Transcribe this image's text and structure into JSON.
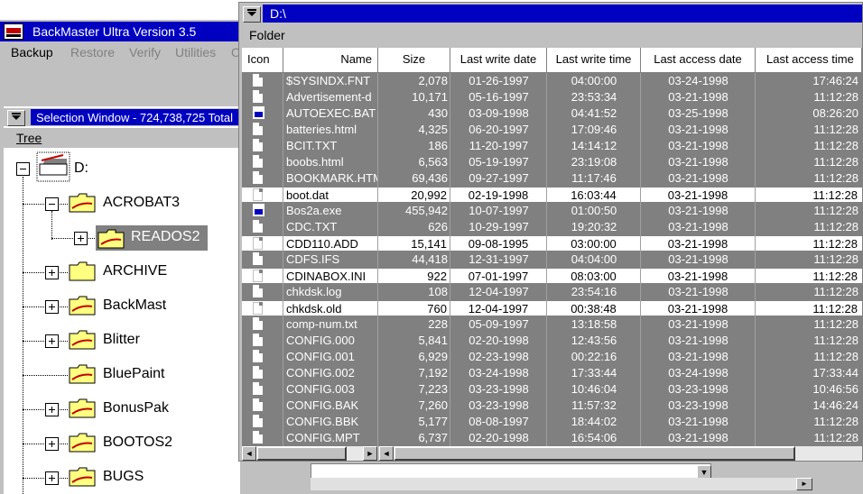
{
  "main_window": {
    "title": "BackMaster Ultra Version 3.5",
    "menu": [
      "Backup",
      "Restore",
      "Verify",
      "Utilities",
      "O"
    ]
  },
  "selection_window": {
    "title": "Selection Window - 724,738,725 Total",
    "menu_tree": "Tree",
    "drive_label": "D:",
    "tree": [
      {
        "label": "ACROBAT3",
        "expander": "minus"
      },
      {
        "label": "READOS2",
        "expander": "plus",
        "selected": true
      },
      {
        "label": "ARCHIVE",
        "expander": "plus"
      },
      {
        "label": "BackMast",
        "expander": "plus"
      },
      {
        "label": "Blitter",
        "expander": "plus"
      },
      {
        "label": "BluePaint",
        "expander": "none"
      },
      {
        "label": "BonusPak",
        "expander": "plus"
      },
      {
        "label": "BOOTOS2",
        "expander": "plus"
      },
      {
        "label": "BUGS",
        "expander": "plus"
      }
    ]
  },
  "folder_window": {
    "title": "D:\\",
    "menu_folder": "Folder",
    "columns": [
      "Icon",
      "Name",
      "Size",
      "Last write date",
      "Last write time",
      "Last access date",
      "Last access time"
    ],
    "rows": [
      {
        "name": "$SYSINDX.FNT",
        "size": "2,078",
        "wdate": "01-26-1997",
        "wtime": "04:00:00",
        "adate": "03-24-1998",
        "atime": "17:46:24",
        "icon": "file"
      },
      {
        "name": "Advertisement-d",
        "size": "10,171",
        "wdate": "05-16-1997",
        "wtime": "23:53:34",
        "adate": "03-21-1998",
        "atime": "11:12:28",
        "icon": "file"
      },
      {
        "name": "AUTOEXEC.BAT",
        "size": "430",
        "wdate": "03-09-1998",
        "wtime": "04:41:52",
        "adate": "03-25-1998",
        "atime": "08:26:20",
        "icon": "program"
      },
      {
        "name": "batteries.html",
        "size": "4,325",
        "wdate": "06-20-1997",
        "wtime": "17:09:46",
        "adate": "03-21-1998",
        "atime": "11:12:28",
        "icon": "file"
      },
      {
        "name": "BCIT.TXT",
        "size": "186",
        "wdate": "11-20-1997",
        "wtime": "14:14:12",
        "adate": "03-21-1998",
        "atime": "11:12:28",
        "icon": "file"
      },
      {
        "name": "boobs.html",
        "size": "6,563",
        "wdate": "05-19-1997",
        "wtime": "23:19:08",
        "adate": "03-21-1998",
        "atime": "11:12:28",
        "icon": "file"
      },
      {
        "name": "BOOKMARK.HTM",
        "size": "69,436",
        "wdate": "09-27-1997",
        "wtime": "11:17:46",
        "adate": "03-21-1998",
        "atime": "11:12:28",
        "icon": "file"
      },
      {
        "name": "boot.dat",
        "size": "20,992",
        "wdate": "02-19-1998",
        "wtime": "16:03:44",
        "adate": "03-21-1998",
        "atime": "11:12:28",
        "icon": "file",
        "selected": true
      },
      {
        "name": "Bos2a.exe",
        "size": "455,942",
        "wdate": "10-07-1997",
        "wtime": "01:00:50",
        "adate": "03-21-1998",
        "atime": "11:12:28",
        "icon": "program"
      },
      {
        "name": "CDC.TXT",
        "size": "626",
        "wdate": "10-29-1997",
        "wtime": "19:20:32",
        "adate": "03-21-1998",
        "atime": "11:12:28",
        "icon": "file"
      },
      {
        "name": "CDD110.ADD",
        "size": "15,141",
        "wdate": "09-08-1995",
        "wtime": "03:00:00",
        "adate": "03-21-1998",
        "atime": "11:12:28",
        "icon": "file",
        "selected": true
      },
      {
        "name": "CDFS.IFS",
        "size": "44,418",
        "wdate": "12-31-1997",
        "wtime": "04:04:00",
        "adate": "03-21-1998",
        "atime": "11:12:28",
        "icon": "file"
      },
      {
        "name": "CDINABOX.INI",
        "size": "922",
        "wdate": "07-01-1997",
        "wtime": "08:03:00",
        "adate": "03-21-1998",
        "atime": "11:12:28",
        "icon": "file",
        "selected": true
      },
      {
        "name": "chkdsk.log",
        "size": "108",
        "wdate": "12-04-1997",
        "wtime": "23:54:16",
        "adate": "03-21-1998",
        "atime": "11:12:28",
        "icon": "file"
      },
      {
        "name": "chkdsk.old",
        "size": "760",
        "wdate": "12-04-1997",
        "wtime": "00:38:48",
        "adate": "03-21-1998",
        "atime": "11:12:28",
        "icon": "file",
        "selected": true
      },
      {
        "name": "comp-num.txt",
        "size": "228",
        "wdate": "05-09-1997",
        "wtime": "13:18:58",
        "adate": "03-21-1998",
        "atime": "11:12:28",
        "icon": "file"
      },
      {
        "name": "CONFIG.000",
        "size": "5,841",
        "wdate": "02-20-1998",
        "wtime": "12:43:56",
        "adate": "03-21-1998",
        "atime": "11:12:28",
        "icon": "file"
      },
      {
        "name": "CONFIG.001",
        "size": "6,929",
        "wdate": "02-23-1998",
        "wtime": "00:22:16",
        "adate": "03-21-1998",
        "atime": "11:12:28",
        "icon": "file"
      },
      {
        "name": "CONFIG.002",
        "size": "7,192",
        "wdate": "03-24-1998",
        "wtime": "17:33:44",
        "adate": "03-24-1998",
        "atime": "17:33:44",
        "icon": "file"
      },
      {
        "name": "CONFIG.003",
        "size": "7,223",
        "wdate": "03-23-1998",
        "wtime": "10:46:04",
        "adate": "03-23-1998",
        "atime": "10:46:56",
        "icon": "file"
      },
      {
        "name": "CONFIG.BAK",
        "size": "7,260",
        "wdate": "03-23-1998",
        "wtime": "11:57:32",
        "adate": "03-23-1998",
        "atime": "14:46:24",
        "icon": "file"
      },
      {
        "name": "CONFIG.BBK",
        "size": "5,177",
        "wdate": "08-08-1997",
        "wtime": "18:44:02",
        "adate": "03-21-1998",
        "atime": "11:12:28",
        "icon": "file"
      },
      {
        "name": "CONFIG.MPT",
        "size": "6,737",
        "wdate": "02-20-1998",
        "wtime": "16:54:06",
        "adate": "03-21-1998",
        "atime": "11:12:28",
        "icon": "file"
      }
    ]
  },
  "colors": {
    "titlebar": "#0000c0",
    "window_face": "#c0c0c0",
    "unselected_row": "#808080",
    "folder_yellow": "#ffff80",
    "folder_accent": "#c00000"
  }
}
